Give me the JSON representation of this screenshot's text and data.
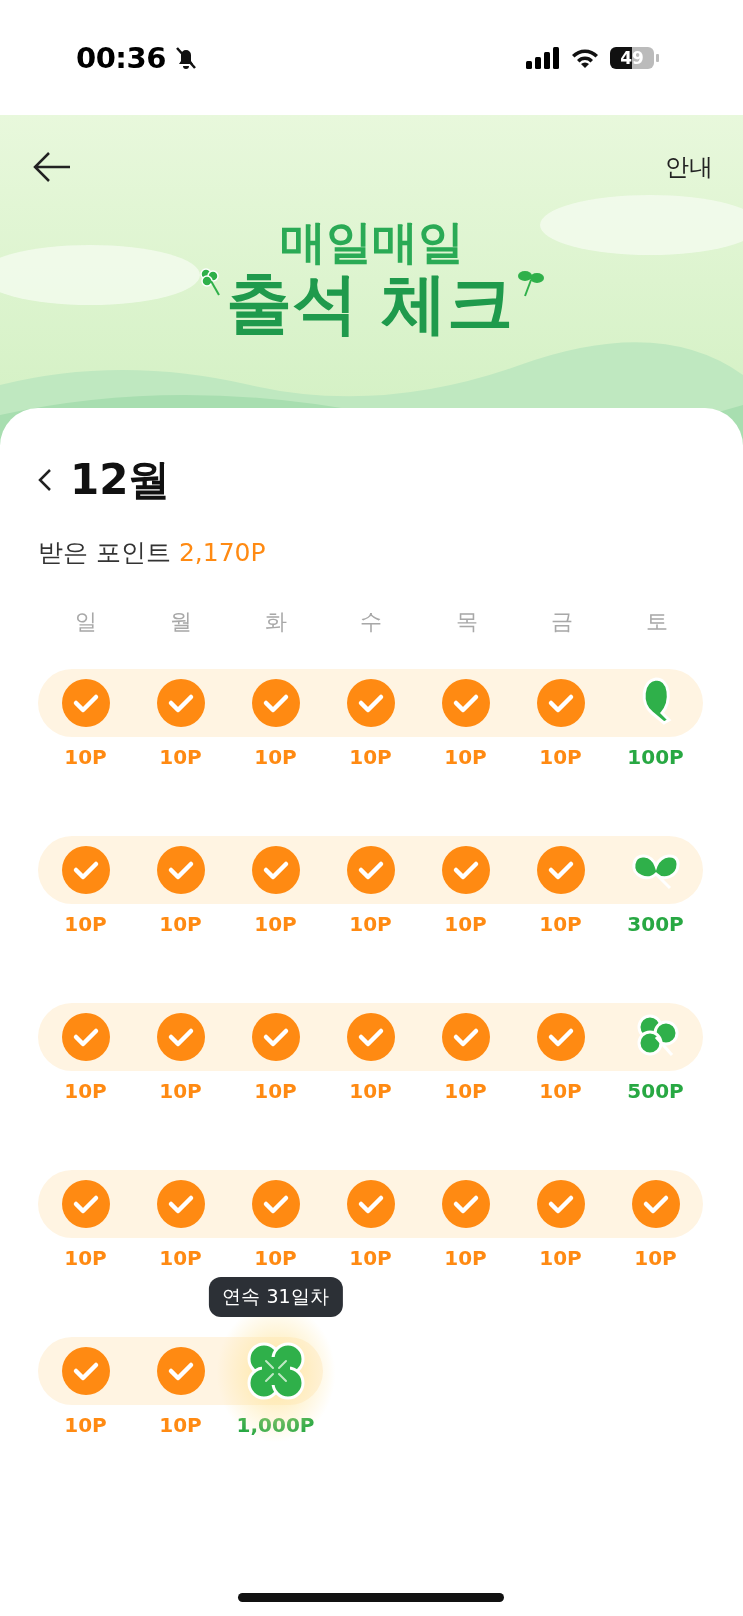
{
  "status_bar": {
    "time": "00:36",
    "battery": "49"
  },
  "header": {
    "info_link": "안내",
    "title_top": "매일매일",
    "title_bottom": "출석 체크"
  },
  "month": {
    "label": "12월"
  },
  "points": {
    "label": "받은 포인트",
    "value": "2,170P"
  },
  "weekdays": [
    "일",
    "월",
    "화",
    "수",
    "목",
    "금",
    "토"
  ],
  "weeks": [
    [
      {
        "kind": "check",
        "points": "10P"
      },
      {
        "kind": "check",
        "points": "10P"
      },
      {
        "kind": "check",
        "points": "10P"
      },
      {
        "kind": "check",
        "points": "10P"
      },
      {
        "kind": "check",
        "points": "10P"
      },
      {
        "kind": "check",
        "points": "10P"
      },
      {
        "kind": "leaf1",
        "points": "100P"
      }
    ],
    [
      {
        "kind": "check",
        "points": "10P"
      },
      {
        "kind": "check",
        "points": "10P"
      },
      {
        "kind": "check",
        "points": "10P"
      },
      {
        "kind": "check",
        "points": "10P"
      },
      {
        "kind": "check",
        "points": "10P"
      },
      {
        "kind": "check",
        "points": "10P"
      },
      {
        "kind": "leaf2",
        "points": "300P"
      }
    ],
    [
      {
        "kind": "check",
        "points": "10P"
      },
      {
        "kind": "check",
        "points": "10P"
      },
      {
        "kind": "check",
        "points": "10P"
      },
      {
        "kind": "check",
        "points": "10P"
      },
      {
        "kind": "check",
        "points": "10P"
      },
      {
        "kind": "check",
        "points": "10P"
      },
      {
        "kind": "leaf3",
        "points": "500P"
      }
    ],
    [
      {
        "kind": "check",
        "points": "10P"
      },
      {
        "kind": "check",
        "points": "10P"
      },
      {
        "kind": "check",
        "points": "10P"
      },
      {
        "kind": "check",
        "points": "10P"
      },
      {
        "kind": "check",
        "points": "10P"
      },
      {
        "kind": "check",
        "points": "10P"
      },
      {
        "kind": "check",
        "points": "10P"
      }
    ],
    [
      {
        "kind": "check",
        "points": "10P"
      },
      {
        "kind": "check",
        "points": "10P"
      },
      {
        "kind": "clover",
        "points": "1,000P",
        "tooltip": "연속 31일차"
      }
    ]
  ]
}
